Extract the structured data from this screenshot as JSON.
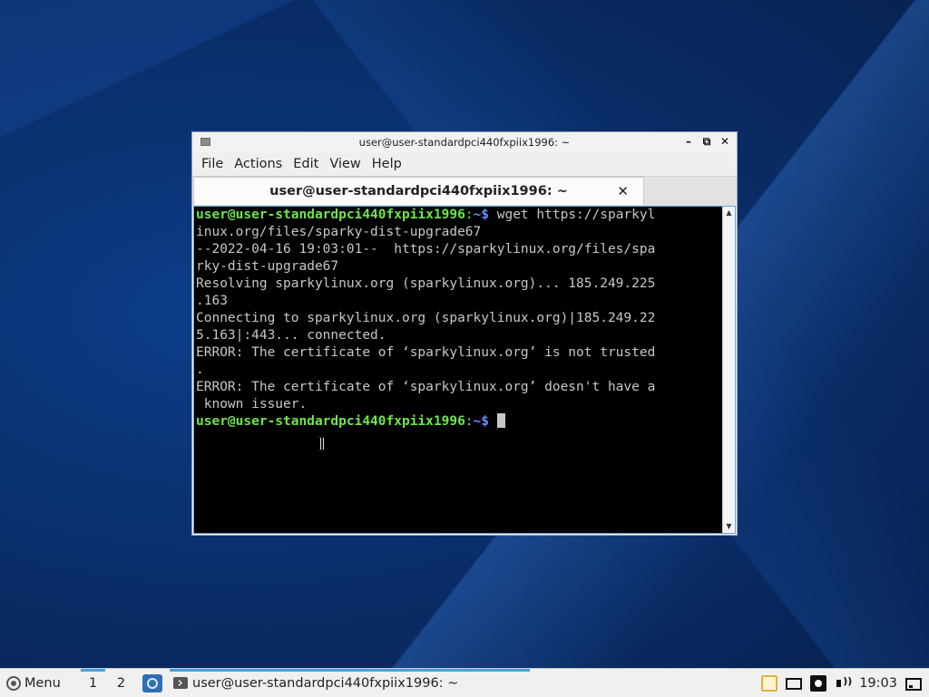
{
  "window": {
    "title": "user@user-standardpci440fxpiix1996: ~",
    "controls": {
      "minimize": "–",
      "maximize": "⧉",
      "close": "✕"
    }
  },
  "menubar": [
    "File",
    "Actions",
    "Edit",
    "View",
    "Help"
  ],
  "tab": {
    "label": "user@user-standardpci440fxpiix1996: ~",
    "close": "✕"
  },
  "terminal": {
    "prompt_user": "user@user-standardpci440fxpiix1996",
    "prompt_sep": ":",
    "prompt_dir": "~$",
    "lines": [
      {
        "prompt": true,
        "text": " wget https://sparkyl"
      },
      {
        "prompt": false,
        "text": "inux.org/files/sparky-dist-upgrade67"
      },
      {
        "prompt": false,
        "text": "--2022-04-16 19:03:01--  https://sparkylinux.org/files/spa"
      },
      {
        "prompt": false,
        "text": "rky-dist-upgrade67"
      },
      {
        "prompt": false,
        "text": "Resolving sparkylinux.org (sparkylinux.org)... 185.249.225"
      },
      {
        "prompt": false,
        "text": ".163"
      },
      {
        "prompt": false,
        "text": "Connecting to sparkylinux.org (sparkylinux.org)|185.249.22"
      },
      {
        "prompt": false,
        "text": "5.163|:443... connected."
      },
      {
        "prompt": false,
        "text": "ERROR: The certificate of ‘sparkylinux.org’ is not trusted"
      },
      {
        "prompt": false,
        "text": "."
      },
      {
        "prompt": false,
        "text": "ERROR: The certificate of ‘sparkylinux.org’ doesn't have a"
      },
      {
        "prompt": false,
        "text": " known issuer."
      },
      {
        "prompt": true,
        "text": " ",
        "cursor": true
      }
    ]
  },
  "taskbar": {
    "menu_label": "Menu",
    "workspaces": [
      "1",
      "2"
    ],
    "task_label": "user@user-standardpci440fxpiix1996: ~",
    "clock": "19:03"
  },
  "icons": {
    "start": "sparky-logo-icon",
    "quicklaunch": "app-launcher-icon",
    "task": "terminal-icon",
    "tray": [
      "clipboard-icon",
      "display-icon",
      "network-icon",
      "volume-icon",
      "show-desktop-icon"
    ]
  }
}
